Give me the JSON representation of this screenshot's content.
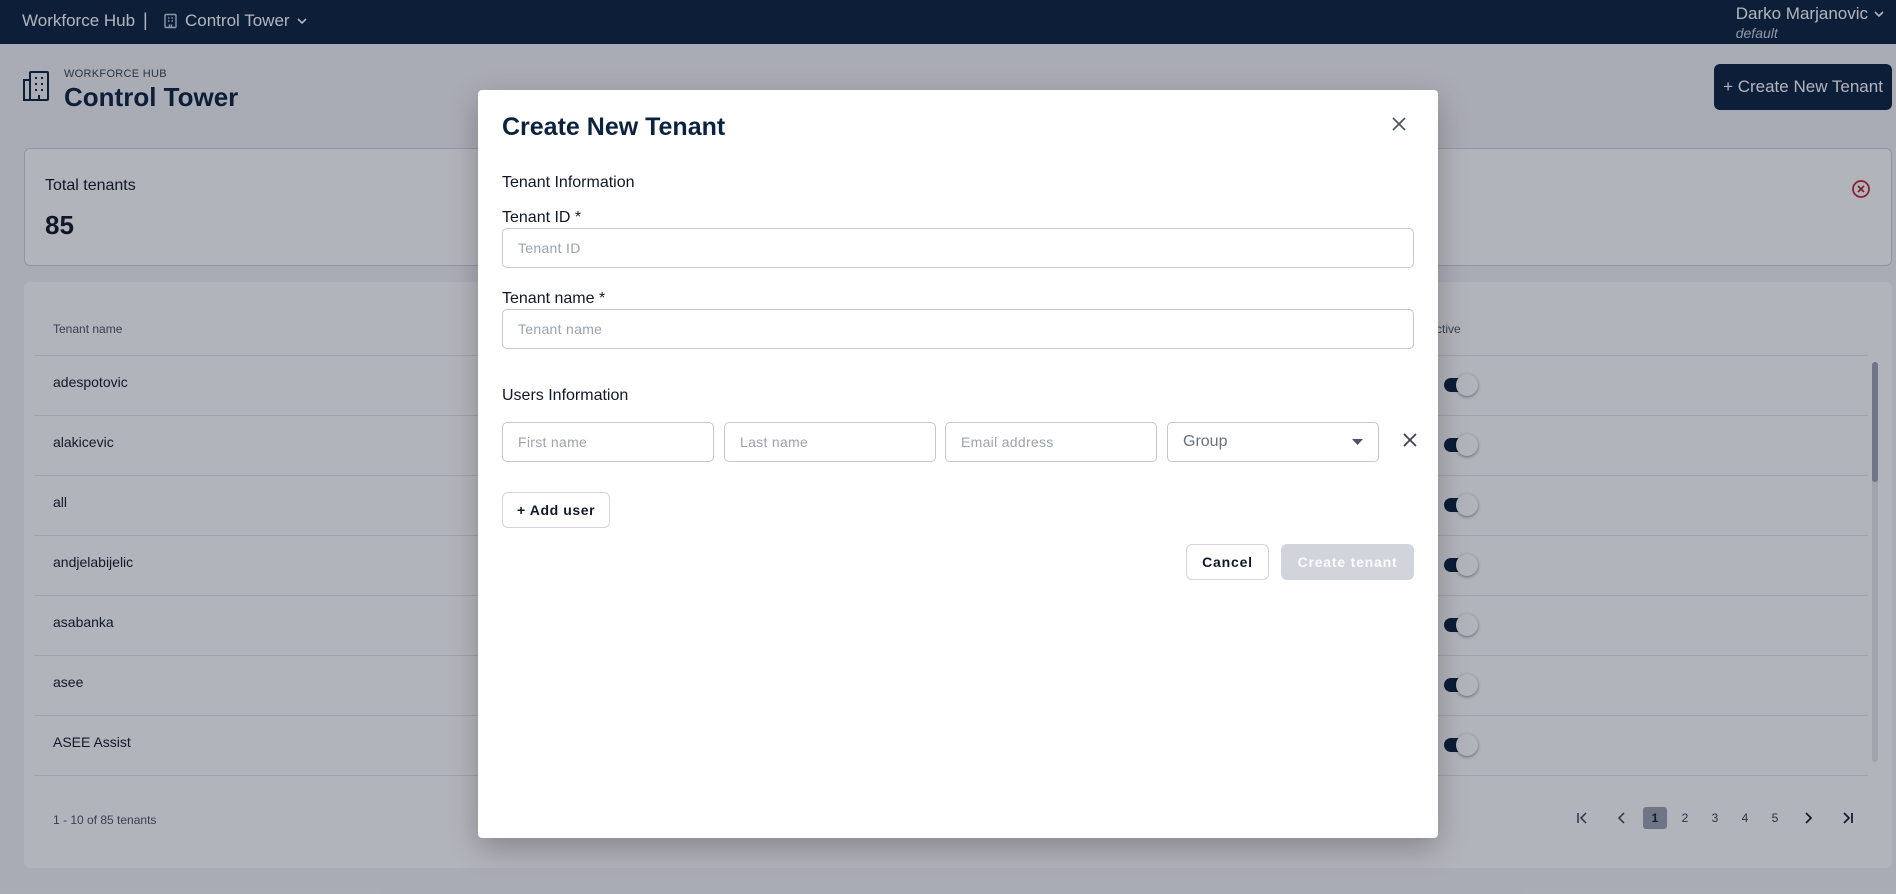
{
  "topbar": {
    "brand": "Workforce Hub",
    "separator": "|",
    "app_name": "Control Tower",
    "user_name": "Darko Marjanovic",
    "user_tenant": "default"
  },
  "page": {
    "eyebrow": "WORKFORCE HUB",
    "title": "Control Tower",
    "create_button": "+ Create New Tenant"
  },
  "stats": {
    "label": "Total tenants",
    "value": "85"
  },
  "table": {
    "columns": [
      "Tenant name",
      "ctive"
    ],
    "rows": [
      {
        "name": "adespotovic",
        "active": true
      },
      {
        "name": "alakicevic",
        "active": true
      },
      {
        "name": "all",
        "active": true
      },
      {
        "name": "andjelabijelic",
        "active": true
      },
      {
        "name": "asabanka",
        "active": true
      },
      {
        "name": "asee",
        "active": true
      },
      {
        "name": "ASEE Assist",
        "active": true
      }
    ],
    "pager_info": "1 - 10 of 85 tenants",
    "pages": [
      "1",
      "2",
      "3",
      "4",
      "5"
    ],
    "current_page": "1"
  },
  "modal": {
    "title": "Create New Tenant",
    "tenant_section": "Tenant Information",
    "tenant_id_label": "Tenant ID *",
    "tenant_id_placeholder": "Tenant ID",
    "tenant_id_value": "",
    "tenant_name_label": "Tenant name *",
    "tenant_name_placeholder": "Tenant name",
    "tenant_name_value": "",
    "users_section": "Users Information",
    "first_name_placeholder": "First name",
    "last_name_placeholder": "Last name",
    "email_placeholder": "Email address",
    "group_placeholder": "Group",
    "add_user": "+ Add user",
    "cancel": "Cancel",
    "submit": "Create tenant"
  },
  "colors": {
    "navy": "#0c2340",
    "danger": "#c0202a",
    "disabled": "#d1d5db"
  },
  "icons": {
    "app": "building-icon",
    "page": "office-building-icon",
    "stats_close": "circle-x-icon",
    "modal_close": "close-icon",
    "group_dropdown": "caret-down-icon",
    "row_remove": "close-icon"
  }
}
